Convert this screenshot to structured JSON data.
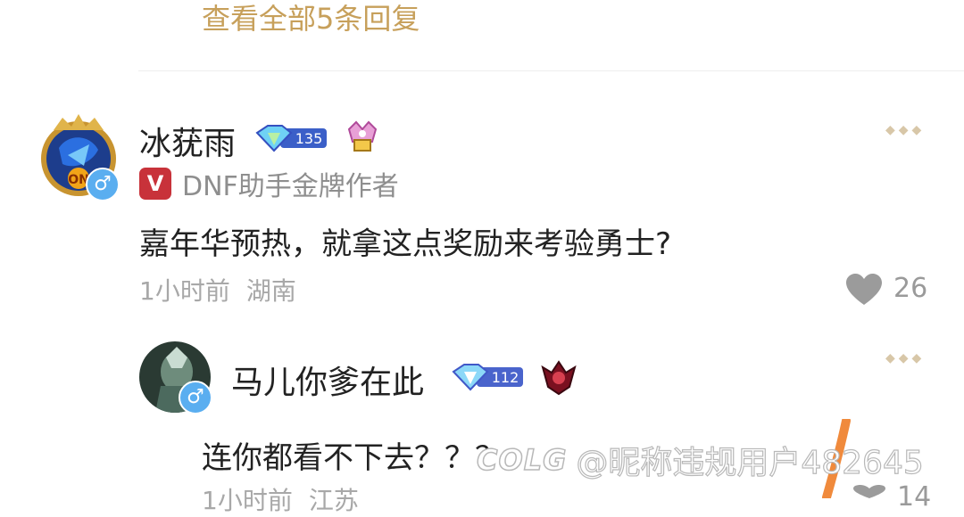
{
  "thread": {
    "view_all_replies": "查看全部5条回复"
  },
  "comment": {
    "username": "冰莸雨",
    "level": "135",
    "title": "DNF助手金牌作者",
    "title_badge": "V",
    "text": "嘉年华预热，就拿这点奖励来考验勇士?",
    "time": "1小时前",
    "location": "湖南",
    "likes": "26",
    "gender": "♂"
  },
  "reply": {
    "username": "马儿你爹在此",
    "level": "112",
    "text": "连你都看不下去？？？",
    "time": "1小时前",
    "location": "江苏",
    "likes": "14",
    "gender": "♂"
  },
  "watermark": {
    "logo": "COLG",
    "text": "@昵称违规用户482645"
  },
  "colors": {
    "accent": "#c7a05b",
    "gender_badge": "#5aaef0",
    "title_badge": "#c8323a"
  }
}
